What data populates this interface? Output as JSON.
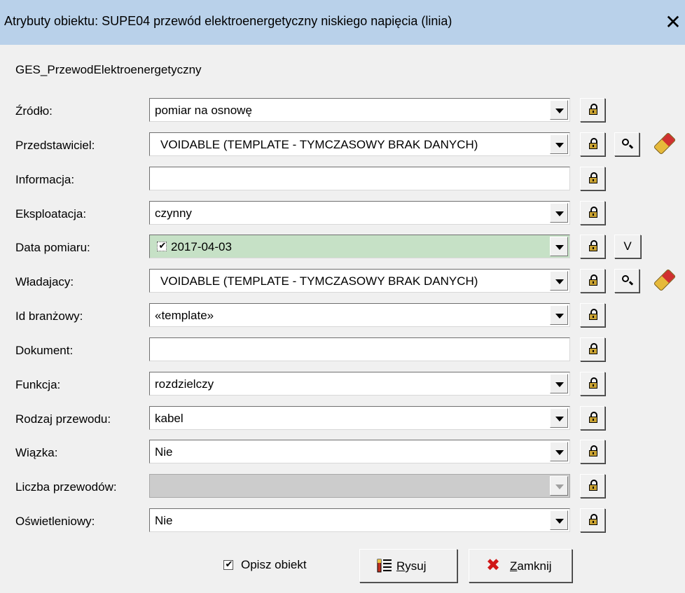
{
  "window": {
    "title": "Atrybuty obiektu: SUPE04 przewód elektroenergetyczny niskiego napięcia (linia)",
    "close_glyph": "✕"
  },
  "class_name": "GES_PrzewodElektroenergetyczny",
  "rows": [
    {
      "label": "Źródło:",
      "value": "pomiar na osnowę"
    },
    {
      "label": "Przedstawiciel:",
      "value": "VOIDABLE (TEMPLATE - TYMCZASOWY BRAK DANYCH)"
    },
    {
      "label": "Informacja:",
      "value": ""
    },
    {
      "label": "Eksploatacja:",
      "value": "czynny"
    },
    {
      "label": "Data pomiaru:",
      "value": "2017-04-03",
      "button": "V"
    },
    {
      "label": "Władajacy:",
      "value": "VOIDABLE (TEMPLATE - TYMCZASOWY BRAK DANYCH)"
    },
    {
      "label": "Id branżowy:",
      "value": "«template»"
    },
    {
      "label": "Dokument:",
      "value": ""
    },
    {
      "label": "Funkcja:",
      "value": "rozdzielczy"
    },
    {
      "label": "Rodzaj przewodu:",
      "value": "kabel"
    },
    {
      "label": "Wiązka:",
      "value": "Nie"
    },
    {
      "label": "Liczba przewodów:",
      "value": ""
    },
    {
      "label": "Oświetleniowy:",
      "value": "Nie"
    }
  ],
  "footer": {
    "describe_label": "Opisz obiekt",
    "draw_label_first": "R",
    "draw_label_rest": "ysuj",
    "close_label_first": "Z",
    "close_label_rest": "amknij"
  },
  "icons": {
    "lock": "lock-icon",
    "search": "magnifier-icon",
    "clear": "eraser-icon",
    "check": "✔",
    "close_x": "✖"
  }
}
